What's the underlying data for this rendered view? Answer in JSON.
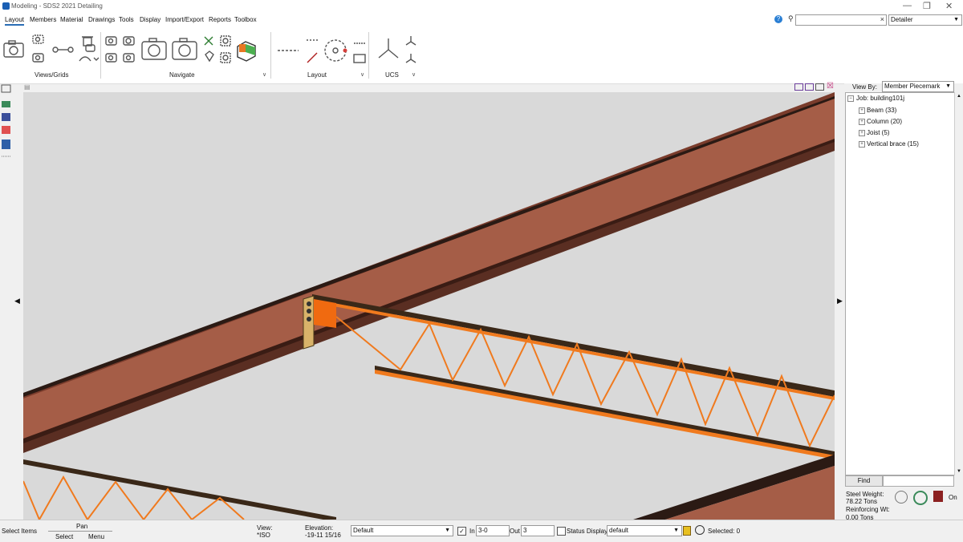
{
  "window": {
    "title": "Modeling - SDS2 2021 Detailing",
    "minimize": "—",
    "restore": "❐",
    "close": "✕"
  },
  "menu": [
    "Layout",
    "Members",
    "Material",
    "Drawings",
    "Tools",
    "Display",
    "Import/Export",
    "Reports",
    "Toolbox"
  ],
  "search": {
    "value": "",
    "clear": "×",
    "role": "Detailer"
  },
  "ribbon": {
    "groups": {
      "views": "Views/Grids",
      "navigate": "Navigate",
      "layout": "Layout",
      "ucs": "UCS"
    }
  },
  "panel": {
    "viewby_label": "View By:",
    "viewby_value": "Member Piecemark",
    "tree": {
      "root": "Job: building101j",
      "items": [
        "Beam (33)",
        "Column (20)",
        "Joist (5)",
        "Vertical brace (15)"
      ]
    },
    "find_label": "Find",
    "find_value": "",
    "steel_weight_label": "Steel Weight:",
    "steel_weight_value": "78.22 Tons",
    "reinforcing_label": "Reinforcing Wt:",
    "reinforcing_value": "0.00 Tons",
    "on_label": "On"
  },
  "status": {
    "mode": "Select Items",
    "mouse_middle": "Pan",
    "mouse_left": "Select",
    "mouse_right": "Menu",
    "view_label": "View:",
    "view_value": "*ISO",
    "elevation_label": "Elevation:",
    "elevation_value": "-19-11 15/16",
    "layer": "Default",
    "in_label": "In",
    "in_value": "3-0",
    "out_label": "Out",
    "out_value": "3",
    "status_display_label": "Status Display",
    "status_display_value": "default",
    "selected": "Selected: 0"
  },
  "colors": {
    "beam": "#a55d47",
    "beam_dark": "#3a1c14",
    "joist": "#f07a1e",
    "plate": "#d9b36a",
    "viewport": "#d9d9d9"
  }
}
